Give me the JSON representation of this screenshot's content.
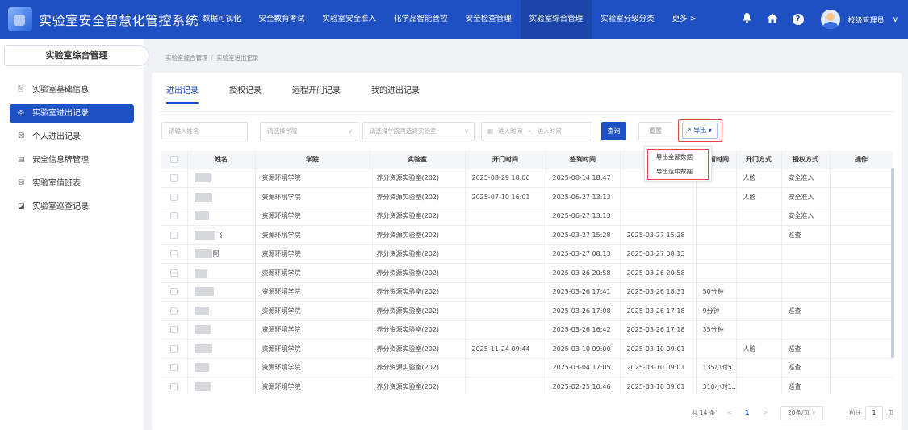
{
  "header": {
    "title": "实验室安全智慧化管控系统",
    "nav": [
      "数据可视化",
      "安全教育考试",
      "实验室安全准入",
      "化学品智能管控",
      "安全检查管理",
      "实验室综合管理",
      "实验室分级分类",
      "更多 >"
    ],
    "active_nav": 5,
    "icons": [
      "bell-icon",
      "home-icon",
      "help-icon"
    ],
    "help_glyph": "?",
    "user_name": "校级管理员",
    "user_caret": "∨"
  },
  "sidebar": {
    "title": "实验室综合管理",
    "items": [
      {
        "label": "实验室基础信息",
        "icon": "🗎"
      },
      {
        "label": "实验室进出记录",
        "icon": "◎"
      },
      {
        "label": "个人进出记录",
        "icon": "☒"
      },
      {
        "label": "安全信息牌管理",
        "icon": "▤"
      },
      {
        "label": "实验室值班表",
        "icon": "☒"
      },
      {
        "label": "实验室巡查记录",
        "icon": "◪"
      }
    ],
    "active_item": 1
  },
  "breadcrumb": [
    "实验室综合管理",
    "实验室进出记录"
  ],
  "breadcrumb_sep": "/",
  "tabs": [
    "进出记录",
    "授权记录",
    "远程开门记录",
    "我的进出记录"
  ],
  "active_tab": 0,
  "filters": {
    "name_placeholder": "请输入姓名",
    "college_placeholder": "请选择学院",
    "lab_placeholder": "请选择学院再选择实验室",
    "caret": "∨",
    "date_icon": "▦",
    "date_start": "进入时间",
    "date_sep": "-",
    "date_end": "进入时间",
    "query": "查询",
    "reset": "重置",
    "export": "导出",
    "export_icon": "↗",
    "export_caret": "▾"
  },
  "export_menu": [
    "导出全部数据",
    "导出选中数据"
  ],
  "table": {
    "columns": [
      "",
      "姓名",
      "学院",
      "实验室",
      "开门时间",
      "签到时间",
      "签退时间",
      "滞留时间",
      "开门方式",
      "授权方式",
      "操作"
    ],
    "rows": [
      {
        "name_tail": "",
        "college": "资源环境学院",
        "lab": "养分资源实验室(202)",
        "open": "2025-08-29 18:06",
        "signin": "2025-08-14 18:47",
        "signout": "",
        "stay": "",
        "method": "人脸",
        "auth": "安全准入"
      },
      {
        "name_tail": "",
        "college": "资源环境学院",
        "lab": "养分资源实验室(202)",
        "open": "2025-07-10 16:01",
        "signin": "2025-06-27 13:13",
        "signout": "",
        "stay": "",
        "method": "人脸",
        "auth": "安全准入"
      },
      {
        "name_tail": "",
        "college": "资源环境学院",
        "lab": "养分资源实验室(202)",
        "open": "",
        "signin": "2025-06-27 13:13",
        "signout": "",
        "stay": "",
        "method": "",
        "auth": "安全准入"
      },
      {
        "name_tail": "飞",
        "college": "资源环境学院",
        "lab": "养分资源实验室(202)",
        "open": "",
        "signin": "2025-03-27 15:28",
        "signout": "2025-03-27 15:28",
        "stay": "",
        "method": "",
        "auth": "巡查"
      },
      {
        "name_tail": "阿",
        "college": "资源环境学院",
        "lab": "养分资源实验室(202)",
        "open": "",
        "signin": "2025-03-27 08:13",
        "signout": "2025-03-27 08:13",
        "stay": "",
        "method": "",
        "auth": ""
      },
      {
        "name_tail": "",
        "college": "资源环境学院",
        "lab": "养分资源实验室(202)",
        "open": "",
        "signin": "2025-03-26 20:58",
        "signout": "2025-03-26 20:58",
        "stay": "",
        "method": "",
        "auth": ""
      },
      {
        "name_tail": "",
        "college": "资源环境学院",
        "lab": "养分资源实验室(202)",
        "open": "",
        "signin": "2025-03-26 17:41",
        "signout": "2025-03-26 18:31",
        "stay": "50分钟",
        "method": "",
        "auth": ""
      },
      {
        "name_tail": "",
        "college": "资源环境学院",
        "lab": "养分资源实验室(202)",
        "open": "",
        "signin": "2025-03-26 17:08",
        "signout": "2025-03-26 17:18",
        "stay": "9分钟",
        "method": "",
        "auth": "巡查"
      },
      {
        "name_tail": "",
        "college": "资源环境学院",
        "lab": "养分资源实验室(202)",
        "open": "",
        "signin": "2025-03-26 16:42",
        "signout": "2025-03-26 17:18",
        "stay": "35分钟",
        "method": "",
        "auth": ""
      },
      {
        "name_tail": "",
        "college": "资源环境学院",
        "lab": "养分资源实验室(202)",
        "open": "2025-11-24 09:44",
        "signin": "2025-03-10 09:00",
        "signout": "2025-03-10 09:01",
        "stay": "",
        "method": "人脸",
        "auth": "巡查"
      },
      {
        "name_tail": "",
        "college": "资源环境学院",
        "lab": "养分资源实验室(202)",
        "open": "",
        "signin": "2025-03-04 17:05",
        "signout": "2025-03-10 09:01",
        "stay": "135小时5...",
        "method": "",
        "auth": "巡查"
      },
      {
        "name_tail": "",
        "college": "资源环境学院",
        "lab": "养分资源实验室(202)",
        "open": "",
        "signin": "2025-02-25 10:46",
        "signout": "2025-03-10 09:01",
        "stay": "310小时1...",
        "method": "",
        "auth": "巡查"
      }
    ]
  },
  "pagination": {
    "total": "共 14 条",
    "prev": "<",
    "page": "1",
    "next": ">",
    "page_size": "20条/页",
    "size_caret": "∨",
    "goto_label": "前往",
    "goto_value": "1",
    "goto_suffix": "页"
  },
  "colors": {
    "primary": "#1e4fc3",
    "highlight": "#e84545"
  }
}
